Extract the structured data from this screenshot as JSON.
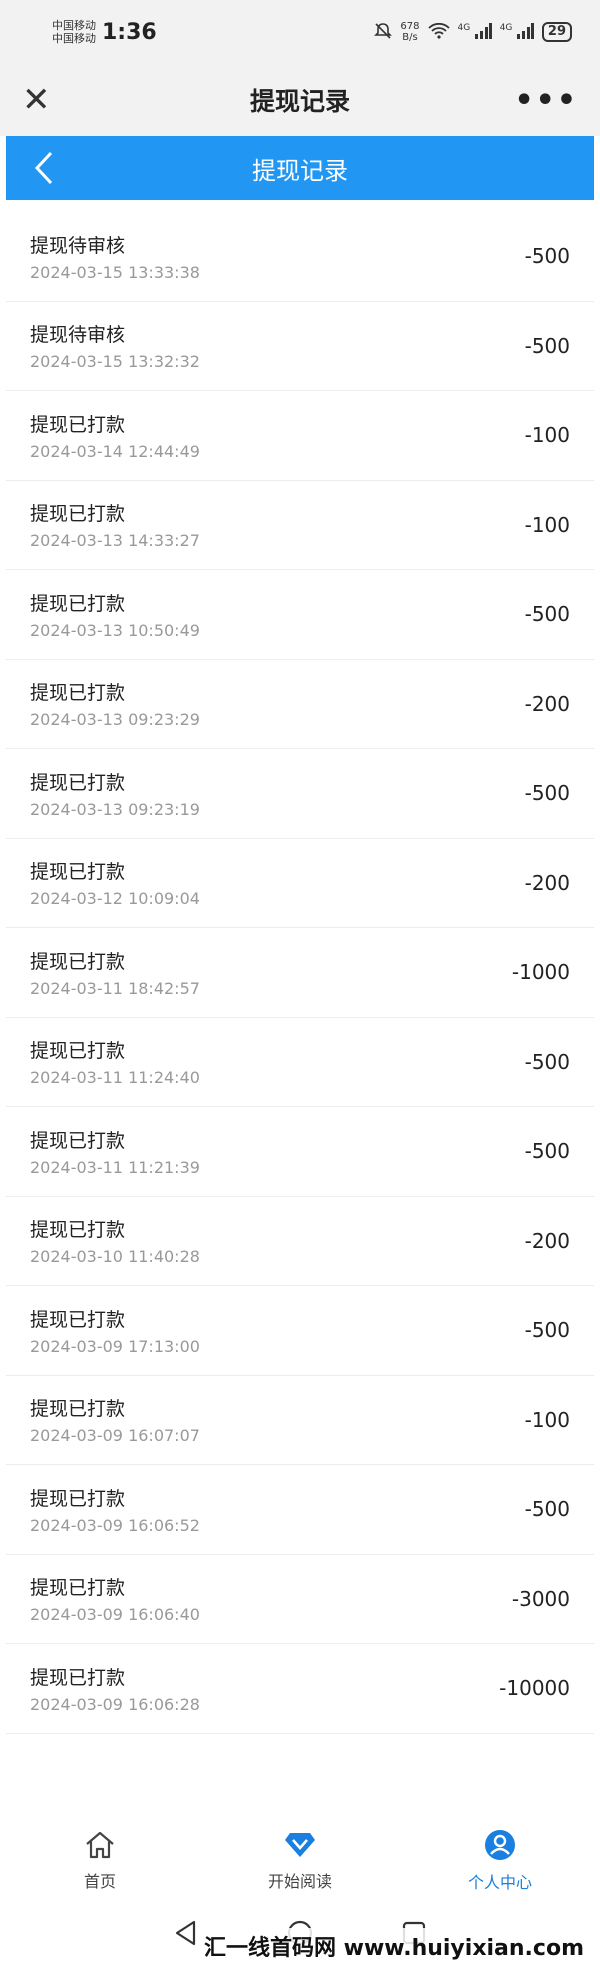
{
  "status_bar": {
    "carrier_1": "中国移动",
    "carrier_2": "中国移动",
    "time": "1:36",
    "net_speed_value": "678",
    "net_speed_unit": "B/s",
    "signal_1": "4G",
    "signal_2": "4G",
    "battery": "29"
  },
  "top_bar": {
    "title": "提现记录",
    "close_icon": "close-icon",
    "more_icon": "more-icon"
  },
  "page_header": {
    "title": "提现记录",
    "back_icon": "chevron-left-icon",
    "color": "#2196f3"
  },
  "records": [
    {
      "status": "提现待审核",
      "date": "2024-03-15 13:33:38",
      "amount": "-500"
    },
    {
      "status": "提现待审核",
      "date": "2024-03-15 13:32:32",
      "amount": "-500"
    },
    {
      "status": "提现已打款",
      "date": "2024-03-14 12:44:49",
      "amount": "-100"
    },
    {
      "status": "提现已打款",
      "date": "2024-03-13 14:33:27",
      "amount": "-100"
    },
    {
      "status": "提现已打款",
      "date": "2024-03-13 10:50:49",
      "amount": "-500"
    },
    {
      "status": "提现已打款",
      "date": "2024-03-13 09:23:29",
      "amount": "-200"
    },
    {
      "status": "提现已打款",
      "date": "2024-03-13 09:23:19",
      "amount": "-500"
    },
    {
      "status": "提现已打款",
      "date": "2024-03-12 10:09:04",
      "amount": "-200"
    },
    {
      "status": "提现已打款",
      "date": "2024-03-11 18:42:57",
      "amount": "-1000"
    },
    {
      "status": "提现已打款",
      "date": "2024-03-11 11:24:40",
      "amount": "-500"
    },
    {
      "status": "提现已打款",
      "date": "2024-03-11 11:21:39",
      "amount": "-500"
    },
    {
      "status": "提现已打款",
      "date": "2024-03-10 11:40:28",
      "amount": "-200"
    },
    {
      "status": "提现已打款",
      "date": "2024-03-09 17:13:00",
      "amount": "-500"
    },
    {
      "status": "提现已打款",
      "date": "2024-03-09 16:07:07",
      "amount": "-100"
    },
    {
      "status": "提现已打款",
      "date": "2024-03-09 16:06:52",
      "amount": "-500"
    },
    {
      "status": "提现已打款",
      "date": "2024-03-09 16:06:40",
      "amount": "-3000"
    },
    {
      "status": "提现已打款",
      "date": "2024-03-09 16:06:28",
      "amount": "-10000"
    }
  ],
  "tab_bar": {
    "tabs": [
      {
        "label": "首页",
        "icon": "home-icon"
      },
      {
        "label": "开始阅读",
        "icon": "diamond-icon"
      },
      {
        "label": "个人中心",
        "icon": "user-icon",
        "active": true
      }
    ],
    "active_color": "#1a7fe0"
  },
  "watermark": "汇一线首码网 www.huiyixian.com"
}
